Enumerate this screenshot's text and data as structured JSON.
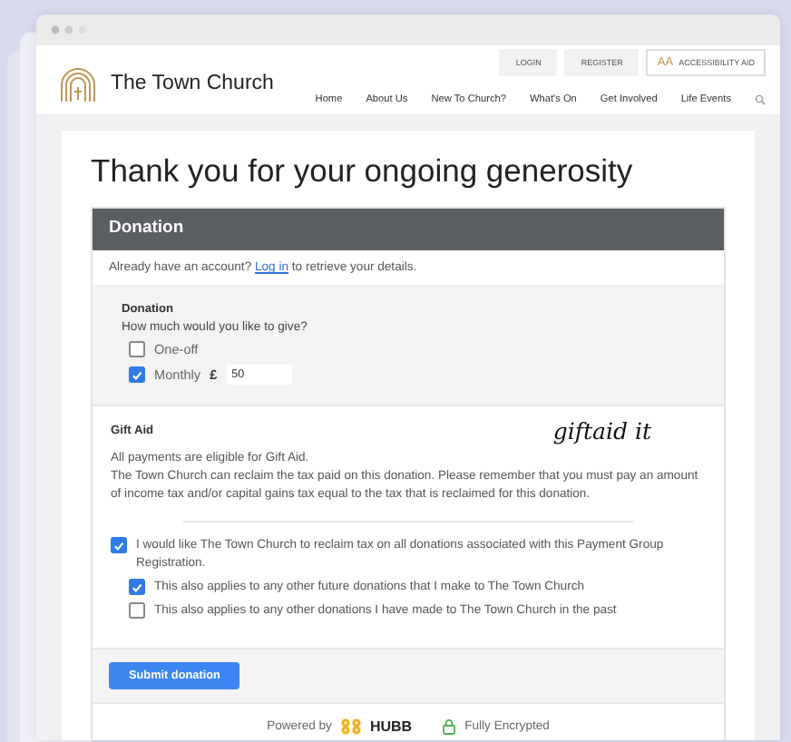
{
  "header": {
    "logo_text": "The Town Church",
    "top_links": [
      "LOGIN",
      "REGISTER"
    ],
    "accessibility": {
      "icon_text": "AA",
      "label": "ACCESSIBILITY AID"
    },
    "nav": [
      "Home",
      "About Us",
      "New To Church?",
      "What's On",
      "Get Involved",
      "Life Events"
    ]
  },
  "page_title": "Thank you for your ongoing generosity",
  "donation_panel": {
    "title": "Donation",
    "login_prompt": {
      "before": "Already have an account?",
      "link": "Log in",
      "after": "to retrieve your details."
    },
    "donation": {
      "heading": "Donation",
      "question": "How much would you like to give?",
      "options": [
        {
          "label": "One-off",
          "checked": false
        },
        {
          "label": "Monthly",
          "checked": true,
          "currency": "£",
          "amount": "50"
        }
      ]
    },
    "gift_aid": {
      "heading": "Gift Aid",
      "logo": "giftaid it",
      "paragraphs": [
        "All payments are eligible for Gift Aid.",
        "The Town Church can reclaim the tax paid on this donation. Please remember that you must pay an amount of income tax and/or capital gains tax equal to the tax that is reclaimed for this donation."
      ],
      "declaration": {
        "label": "I would like The Town Church to reclaim tax on all donations associated with this Payment Group Registration.",
        "checked": true
      },
      "sub_options": [
        {
          "label": "This also applies to any other future donations that I make to The Town Church",
          "checked": true
        },
        {
          "label": "This also applies to any other donations I have made to The Town Church in the past",
          "checked": false
        }
      ]
    },
    "submit": "Submit donation",
    "footer": {
      "powered_by": "Powered by",
      "brand": "HUBB",
      "security": "Fully Encrypted"
    }
  }
}
